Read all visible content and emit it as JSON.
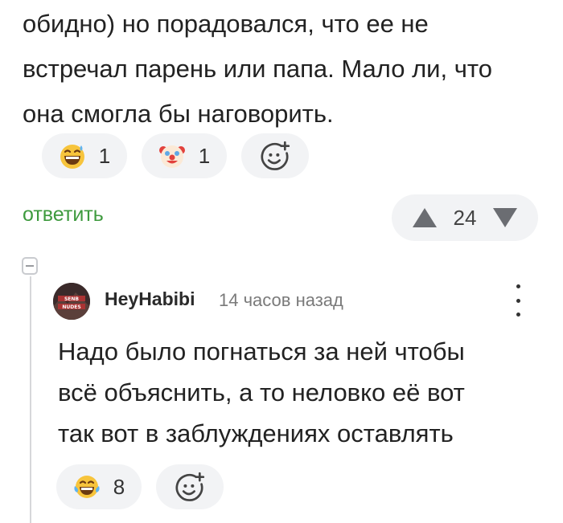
{
  "comment": {
    "text_lines": [
      "обидно) но порадовался, что ее не",
      "встречал парень или папа. Мало ли, что",
      "она смогла бы наговорить."
    ],
    "reactions": [
      {
        "icon": "grinning-sweat-emoji-icon",
        "count": "1"
      },
      {
        "icon": "clown-face-emoji-icon",
        "count": "1"
      }
    ],
    "add_reaction_icon": "add-emoji-icon",
    "reply_label": "ответить",
    "rating": "24"
  },
  "reply": {
    "author": "HeyHabibi",
    "avatar_text": "SENB NUDES",
    "time": "14 часов назад",
    "text_lines": [
      "Надо было погнаться за ней чтобы",
      "всё объяснить, а то неловко её вот",
      "так вот в заблуждениях оставлять"
    ],
    "reactions": [
      {
        "icon": "tears-of-joy-emoji-icon",
        "count": "8"
      }
    ],
    "add_reaction_icon": "add-emoji-icon"
  },
  "colors": {
    "accent_green": "#3e9a3e",
    "pill_bg": "#f2f3f5",
    "emoji_yellow": "#f7c43c"
  }
}
